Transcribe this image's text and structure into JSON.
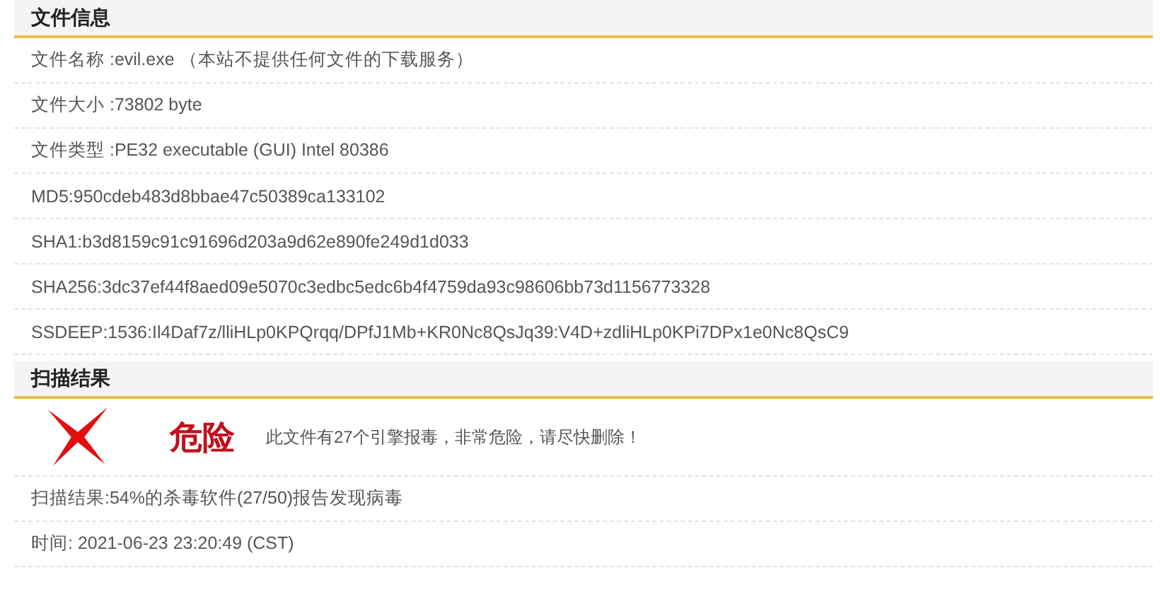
{
  "sections": [
    {
      "title": "文件信息",
      "rows": [
        "文件名称 :evil.exe （本站不提供任何文件的下载服务）",
        "文件大小 :73802 byte",
        "文件类型 :PE32 executable (GUI) Intel 80386",
        "MD5:950cdeb483d8bbae47c50389ca133102",
        "SHA1:b3d8159c91c91696d203a9d62e890fe249d1d033",
        "SHA256:3dc37ef44f8aed09e5070c3edbc5edc6b4f4759da93c98606bb73d1156773328",
        "SSDEEP:1536:Il4Daf7z/lliHLp0KPQrqq/DPfJ1Mb+KR0Nc8QsJq39:V4D+zdliHLp0KPi7DPx1e0Nc8QsC9"
      ]
    },
    {
      "title": "扫描结果",
      "verdict": {
        "kind": "danger",
        "label": "危险",
        "message": "此文件有27个引擎报毒，非常危险，请尽快删除！"
      },
      "rows": [
        "扫描结果:54%的杀毒软件(27/50)报告发现病毒",
        "时间: 2021-06-23 23:20:49 (CST)"
      ]
    }
  ]
}
